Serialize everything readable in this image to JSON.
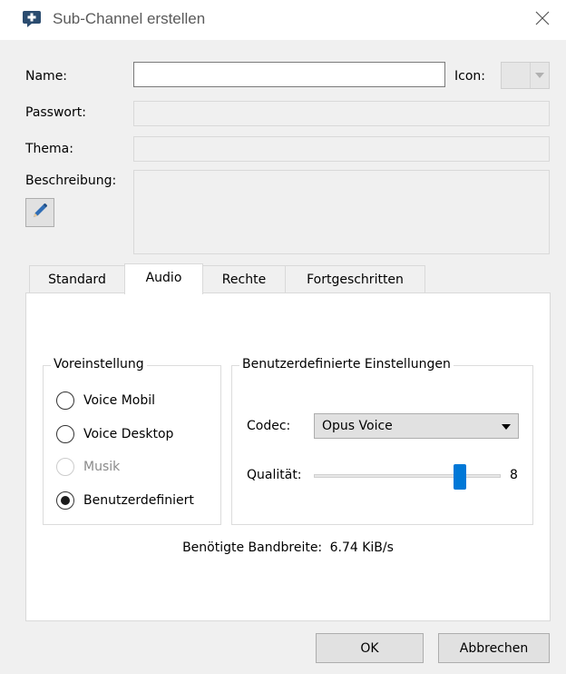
{
  "window": {
    "title": "Sub-Channel erstellen",
    "title_icon": "plus-badge-icon",
    "close_icon": "close-icon"
  },
  "form": {
    "name_label": "Name:",
    "name_value": "",
    "icon_label": "Icon:",
    "password_label": "Passwort:",
    "topic_label": "Thema:",
    "description_label": "Beschreibung:",
    "edit_icon": "pencil-icon"
  },
  "tabs": [
    {
      "label": "Standard",
      "active": false
    },
    {
      "label": "Audio",
      "active": true
    },
    {
      "label": "Rechte",
      "active": false
    },
    {
      "label": "Fortgeschritten",
      "active": false
    }
  ],
  "audio": {
    "preset_group_title": "Voreinstellung",
    "presets": [
      {
        "label": "Voice Mobil",
        "checked": false,
        "enabled": true
      },
      {
        "label": "Voice Desktop",
        "checked": false,
        "enabled": true
      },
      {
        "label": "Musik",
        "checked": false,
        "enabled": false
      },
      {
        "label": "Benutzerdefiniert",
        "checked": true,
        "enabled": true
      }
    ],
    "custom_group_title": "Benutzerdefinierte Einstellungen",
    "codec_label": "Codec:",
    "codec_value": "Opus Voice",
    "quality_label": "Qualität:",
    "quality_value": 8,
    "quality_value_text": "8",
    "quality_max": 10,
    "bandwidth_label": "Benötigte Bandbreite:",
    "bandwidth_value": "6.74 KiB/s"
  },
  "buttons": {
    "ok_label": "OK",
    "cancel_label": "Abbrechen"
  },
  "colors": {
    "accent": "#0078d7",
    "title_icon": "#2b4c6f"
  }
}
